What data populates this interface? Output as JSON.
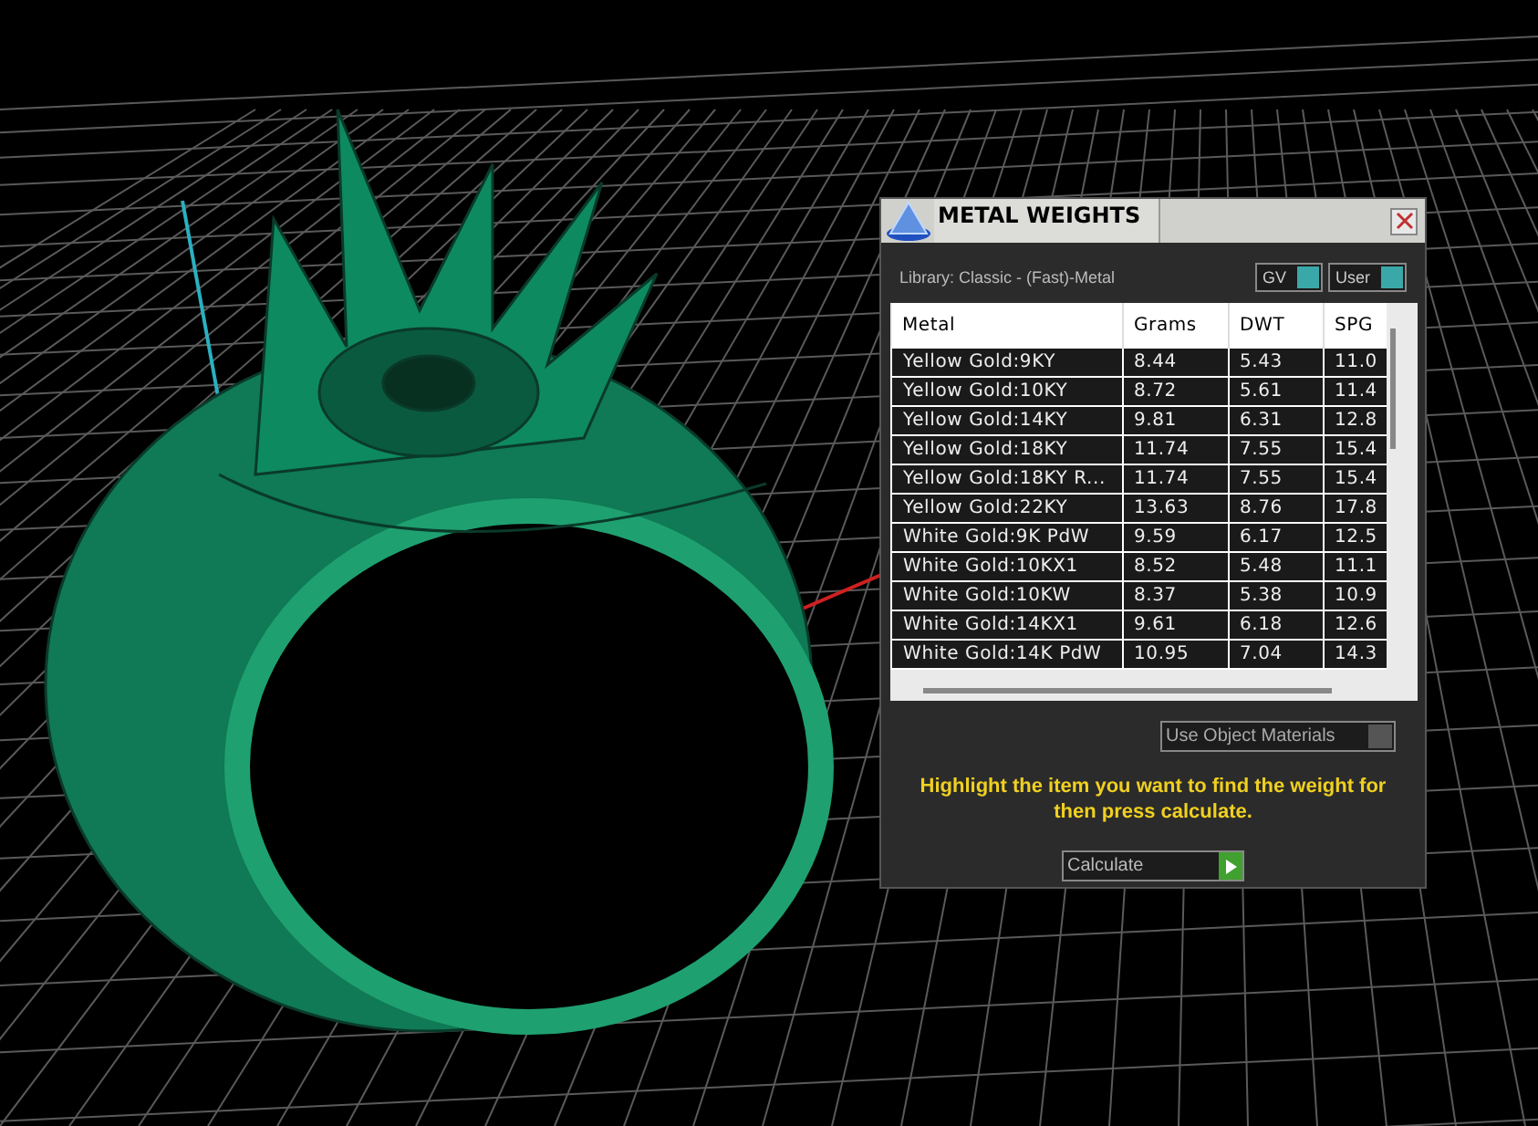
{
  "panel": {
    "title": "METAL WEIGHTS",
    "library": "Library: Classic - (Fast)-Metal",
    "toggles": [
      {
        "label": "GV",
        "on": true
      },
      {
        "label": "User",
        "on": true
      }
    ],
    "table": {
      "columns": [
        "Metal",
        "Grams",
        "DWT",
        "SPG"
      ],
      "rows": [
        [
          "Yellow Gold:9KY",
          "8.44",
          "5.43",
          "11.0"
        ],
        [
          "Yellow Gold:10KY",
          "8.72",
          "5.61",
          "11.4"
        ],
        [
          "Yellow Gold:14KY",
          "9.81",
          "6.31",
          "12.8"
        ],
        [
          "Yellow Gold:18KY",
          "11.74",
          "7.55",
          "15.4"
        ],
        [
          "Yellow Gold:18KY R...",
          "11.74",
          "7.55",
          "15.4"
        ],
        [
          "Yellow Gold:22KY",
          "13.63",
          "8.76",
          "17.8"
        ],
        [
          "White Gold:9K PdW",
          "9.59",
          "6.17",
          "12.5"
        ],
        [
          "White Gold:10KX1",
          "8.52",
          "5.48",
          "11.1"
        ],
        [
          "White Gold:10KW",
          "8.37",
          "5.38",
          "10.9"
        ],
        [
          "White Gold:14KX1",
          "9.61",
          "6.18",
          "12.6"
        ],
        [
          "White Gold:14K PdW",
          "10.95",
          "7.04",
          "14.3"
        ]
      ]
    },
    "option": {
      "label": "Use Object Materials",
      "on": false
    },
    "hint": "Highlight the item you want to find the weight for then press calculate.",
    "button": "Calculate"
  }
}
